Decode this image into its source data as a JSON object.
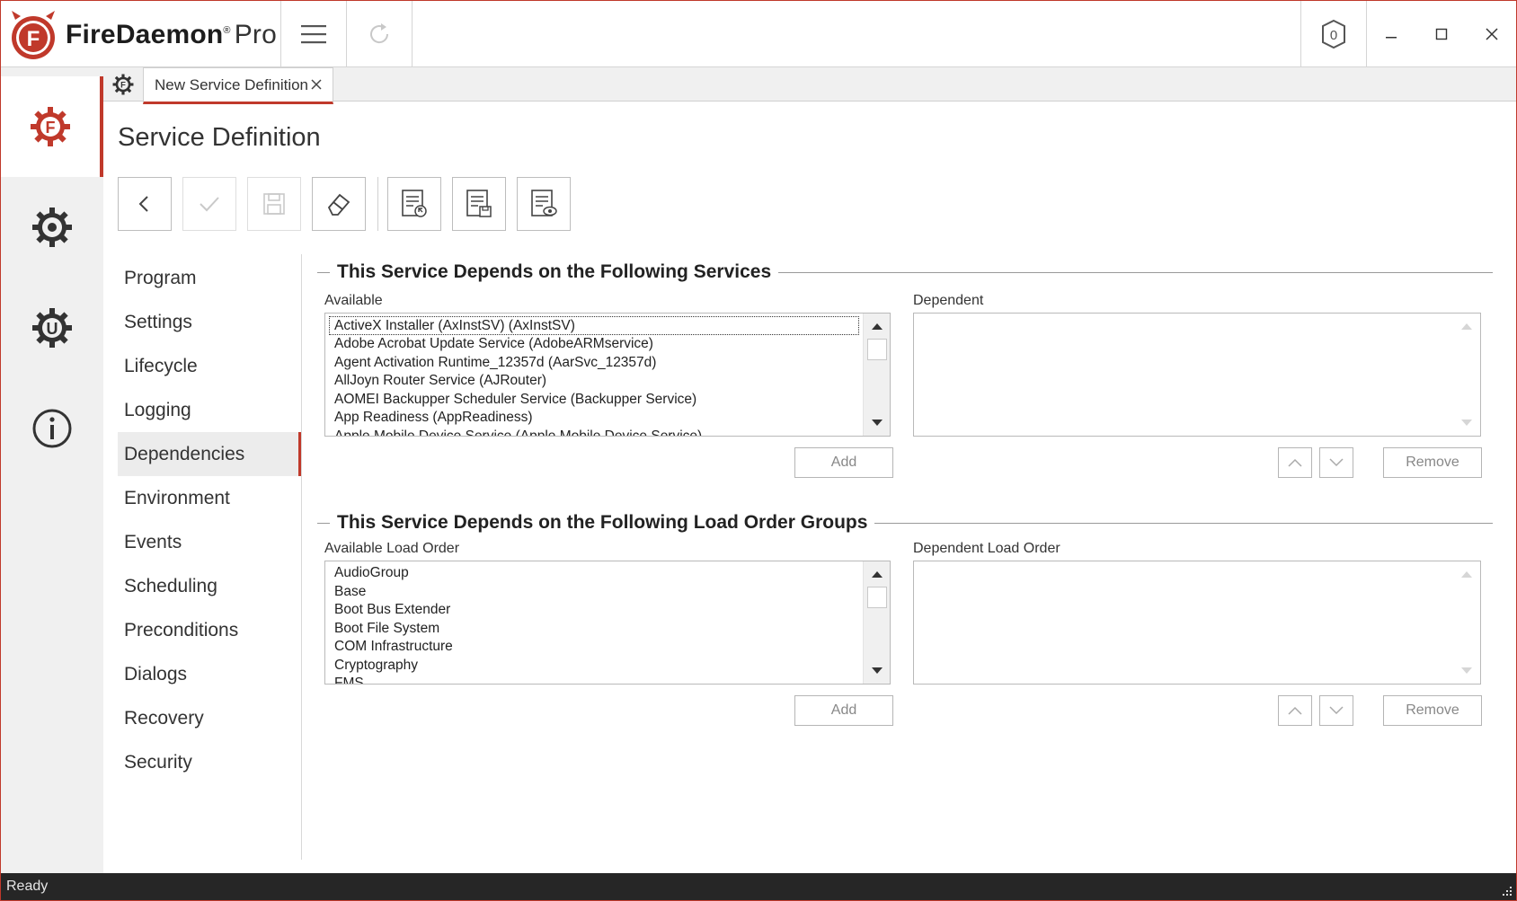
{
  "app": {
    "brand_name": "FireDaemon",
    "brand_reg": "®",
    "edition": "Pro",
    "colors": {
      "accent": "#c0392b",
      "statusbar": "#262626",
      "rail": "#f0f0f0"
    }
  },
  "titlebar": {
    "icons": [
      "hamburger-menu-icon",
      "refresh-icon",
      "tray-icon",
      "minimize-icon",
      "maximize-icon",
      "close-icon"
    ]
  },
  "rail": {
    "items": [
      {
        "name": "services",
        "icon": "firedaemon-gear-icon",
        "active": true
      },
      {
        "name": "windows-services",
        "icon": "gear-icon",
        "active": false
      },
      {
        "name": "fusion",
        "icon": "u-gear-icon",
        "active": false
      },
      {
        "name": "about",
        "icon": "info-icon",
        "active": false
      }
    ]
  },
  "tabs": {
    "active_label": "New Service Definition"
  },
  "page": {
    "title": "Service Definition"
  },
  "toolbar": {
    "buttons": [
      {
        "name": "back",
        "icon": "chevron-left-icon",
        "enabled": true
      },
      {
        "name": "apply",
        "icon": "check-icon",
        "enabled": false
      },
      {
        "name": "save",
        "icon": "save-icon",
        "enabled": false
      },
      {
        "name": "clear",
        "icon": "eraser-icon",
        "enabled": true
      },
      {
        "name": "import",
        "icon": "document-import-icon",
        "enabled": true
      },
      {
        "name": "export",
        "icon": "document-export-icon",
        "enabled": true
      },
      {
        "name": "view",
        "icon": "document-view-icon",
        "enabled": true
      }
    ]
  },
  "section_nav": {
    "items": [
      "Program",
      "Settings",
      "Lifecycle",
      "Logging",
      "Dependencies",
      "Environment",
      "Events",
      "Scheduling",
      "Preconditions",
      "Dialogs",
      "Recovery",
      "Security"
    ],
    "active": "Dependencies"
  },
  "services_group": {
    "title": "This Service Depends on the Following Services",
    "available_label": "Available",
    "dependent_label": "Dependent",
    "available_items": [
      "ActiveX Installer (AxInstSV) (AxInstSV)",
      "Adobe Acrobat Update Service (AdobeARMservice)",
      "Agent Activation Runtime_12357d (AarSvc_12357d)",
      "AllJoyn Router Service (AJRouter)",
      "AOMEI Backupper Scheduler Service (Backupper Service)",
      "App Readiness (AppReadiness)",
      "Apple Mobile Device Service (Apple Mobile Device Service)"
    ],
    "add_label": "Add",
    "remove_label": "Remove"
  },
  "load_order_group": {
    "title": "This Service Depends on the Following Load Order Groups",
    "available_label": "Available Load Order",
    "dependent_label": "Dependent Load Order",
    "available_items": [
      "AudioGroup",
      "Base",
      "Boot Bus Extender",
      "Boot File System",
      "COM Infrastructure",
      "Cryptography",
      "FMS"
    ],
    "add_label": "Add",
    "remove_label": "Remove"
  },
  "statusbar": {
    "text": "Ready"
  }
}
